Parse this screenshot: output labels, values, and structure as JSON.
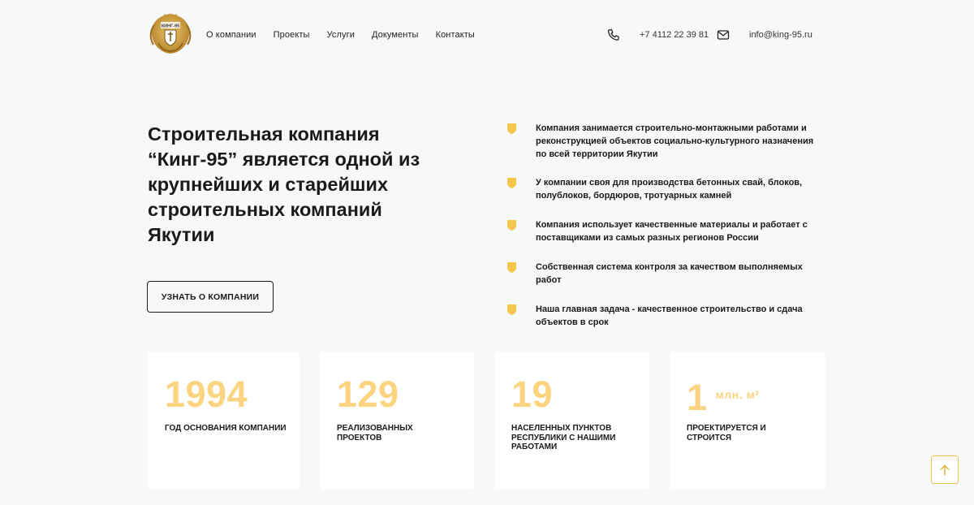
{
  "header": {
    "logo_text": "КИНГ-95",
    "nav": [
      "О компании",
      "Проекты",
      "Услуги",
      "Документы",
      "Контакты"
    ],
    "phone": "+7 4112 22 39 81",
    "email": "info@king-95.ru",
    "phone_icon": "phone-icon",
    "mail_icon": "mail-icon"
  },
  "hero": {
    "title": "Строительная компания “Кинг-95” является одной из крупнейших и старейших строительных компаний Якутии",
    "button_label": "УЗНАТЬ О КОМПАНИИ"
  },
  "features": [
    "Компания занимается строительно-монтажными работами и реконструкцией объектов социально-культурного назначения по всей территории Якутии",
    "У компании своя для производства бетонных свай, блоков, полублоков, бордюров, тротуарных камней",
    "Компания использует качественные материалы и работает с поставщиками из самых разных регионов России",
    "Собственная система контроля за качеством выполняемых работ",
    "Наша главная задача - качественное строительство и сдача объектов в срок"
  ],
  "stats": [
    {
      "value": "1994",
      "unit": "",
      "label": "ГОД ОСНОВАНИЯ КОМПАНИИ"
    },
    {
      "value": "129",
      "unit": "",
      "label": "РЕАЛИЗОВАННЫХ ПРОЕКТОВ"
    },
    {
      "value": "19",
      "unit": "",
      "label": "НАСЕЛЕННЫХ ПУНКТОВ РЕСПУБЛИКИ С НАШИМИ РАБОТАМИ"
    },
    {
      "value": "1",
      "unit": "млн. м²",
      "label": "ПРОЕКТИРУЕТСЯ И СТРОИТСЯ"
    }
  ],
  "scroll_top_icon": "arrow-up-icon",
  "colors": {
    "accent": "#fcd37f",
    "shield": "#f6c64a",
    "background": "#f7f8fa"
  }
}
